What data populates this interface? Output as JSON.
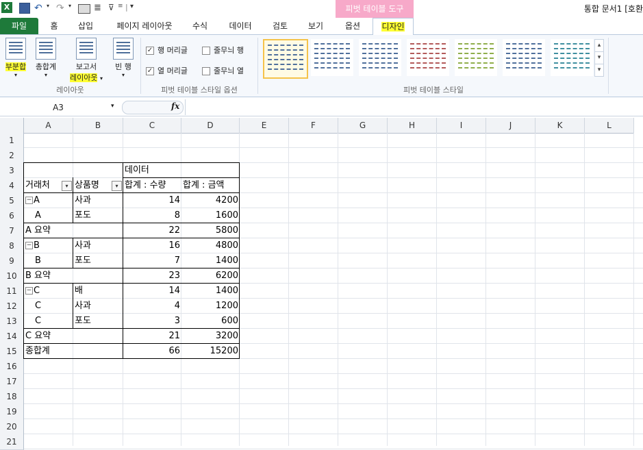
{
  "title_bar": {
    "context_tools": "피벗 테이블 도구",
    "document_title": "통합 문서1  [호환"
  },
  "tabs": [
    "파일",
    "홈",
    "삽입",
    "페이지 레이아웃",
    "수식",
    "데이터",
    "검토",
    "보기",
    "옵션",
    "디자인"
  ],
  "ribbon": {
    "layout": {
      "subtotals": "부분합",
      "grand_totals": "총합계",
      "report_layout_1": "보고서",
      "report_layout_2": "레이아웃",
      "blank_rows": "빈 행",
      "group_label": "레이아웃"
    },
    "style_options": {
      "row_headers": "행 머리글",
      "banded_rows": "줄무늬 행",
      "column_headers": "열 머리글",
      "banded_columns": "줄무늬 열",
      "row_headers_checked": true,
      "column_headers_checked": true,
      "banded_rows_checked": false,
      "banded_columns_checked": false,
      "group_label": "피벗 테이블 스타일 옵션"
    },
    "styles": {
      "group_label": "피벗 테이블 스타일",
      "swatch_colors": [
        "#4f6f9c",
        "#4f6f9c",
        "#4f6f9c",
        "#b35a5a",
        "#8fae4a",
        "#4f6f9c",
        "#3f8fa0"
      ]
    }
  },
  "formula_bar": {
    "name_box": "A3",
    "fx": "fx",
    "formula": ""
  },
  "columns": [
    "A",
    "B",
    "C",
    "D",
    "E",
    "F",
    "G",
    "H",
    "I",
    "J",
    "K",
    "L"
  ],
  "rows": [
    "1",
    "2",
    "3",
    "4",
    "5",
    "6",
    "7",
    "8",
    "9",
    "10",
    "11",
    "12",
    "13",
    "14",
    "15",
    "16",
    "17",
    "18",
    "19",
    "20",
    "21"
  ],
  "pivot": {
    "data_header": "데이터",
    "headers": [
      "거래처",
      "상품명",
      "합계 : 수량",
      "합계 : 금액"
    ],
    "cells": [
      {
        "a": "A",
        "b": "사과",
        "c": "14",
        "d": "4200",
        "minus": true
      },
      {
        "a": "A",
        "b": "포도",
        "c": "8",
        "d": "1600",
        "minus": false
      },
      {
        "a": "A 요약",
        "b": "",
        "c": "22",
        "d": "5800",
        "minus": false
      },
      {
        "a": "B",
        "b": "사과",
        "c": "16",
        "d": "4800",
        "minus": true
      },
      {
        "a": "B",
        "b": "포도",
        "c": "7",
        "d": "1400",
        "minus": false
      },
      {
        "a": "B 요약",
        "b": "",
        "c": "23",
        "d": "6200",
        "minus": false
      },
      {
        "a": "C",
        "b": "배",
        "c": "14",
        "d": "1400",
        "minus": true
      },
      {
        "a": "C",
        "b": "사과",
        "c": "4",
        "d": "1200",
        "minus": false
      },
      {
        "a": "C",
        "b": "포도",
        "c": "3",
        "d": "600",
        "minus": false
      },
      {
        "a": "C 요약",
        "b": "",
        "c": "21",
        "d": "3200",
        "minus": false
      },
      {
        "a": "종합계",
        "b": "",
        "c": "66",
        "d": "15200",
        "minus": false
      }
    ]
  }
}
